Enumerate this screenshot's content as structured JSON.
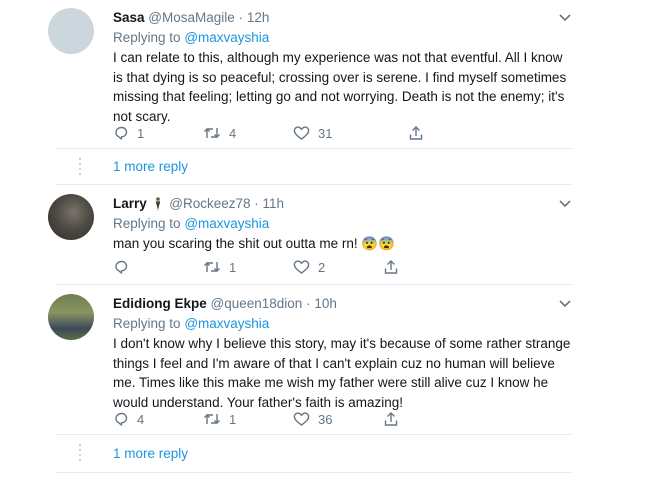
{
  "tweets": [
    {
      "name": "Sasa",
      "handle": "@MosaMagile",
      "sep": "·",
      "time": "12h",
      "reply_prefix": "Replying to",
      "reply_mention": "@maxvayshia",
      "text": "I can relate to this, although my experience was not that eventful. All I know is that dying is so peaceful; crossing over is serene. I find myself sometimes missing that feeling; letting go and not worrying. Death is not the enemy; it's not scary.",
      "replies": "1",
      "retweets": "4",
      "likes": "31",
      "more_replies": "1 more reply"
    },
    {
      "name": "Larry",
      "name_emoji": "🕴",
      "handle": "@Rockeez78",
      "sep": "·",
      "time": "11h",
      "reply_prefix": "Replying to",
      "reply_mention": "@maxvayshia",
      "text": "man you scaring the shit out outta me rn!",
      "emojis": "😨😨",
      "replies": "",
      "retweets": "1",
      "likes": "2"
    },
    {
      "name": "Edidiong Ekpe",
      "handle": "@queen18dion",
      "sep": "·",
      "time": "10h",
      "reply_prefix": "Replying to",
      "reply_mention": "@maxvayshia",
      "text": "I don't know why I believe this story, may it's because of some rather strange things I feel and I'm aware of that I can't explain cuz no human will believe me. Times like this make me wish my father were still alive cuz I know he would understand. Your father's faith is amazing!",
      "replies": "4",
      "retweets": "1",
      "likes": "36",
      "more_replies": "1 more reply"
    }
  ],
  "colors": {
    "text": "#14171a",
    "muted": "#657786",
    "link": "#1b95e0",
    "divider": "#e6ecf0"
  },
  "icons": [
    "reply-icon",
    "retweet-icon",
    "like-icon",
    "share-icon",
    "chevron-down-icon"
  ]
}
